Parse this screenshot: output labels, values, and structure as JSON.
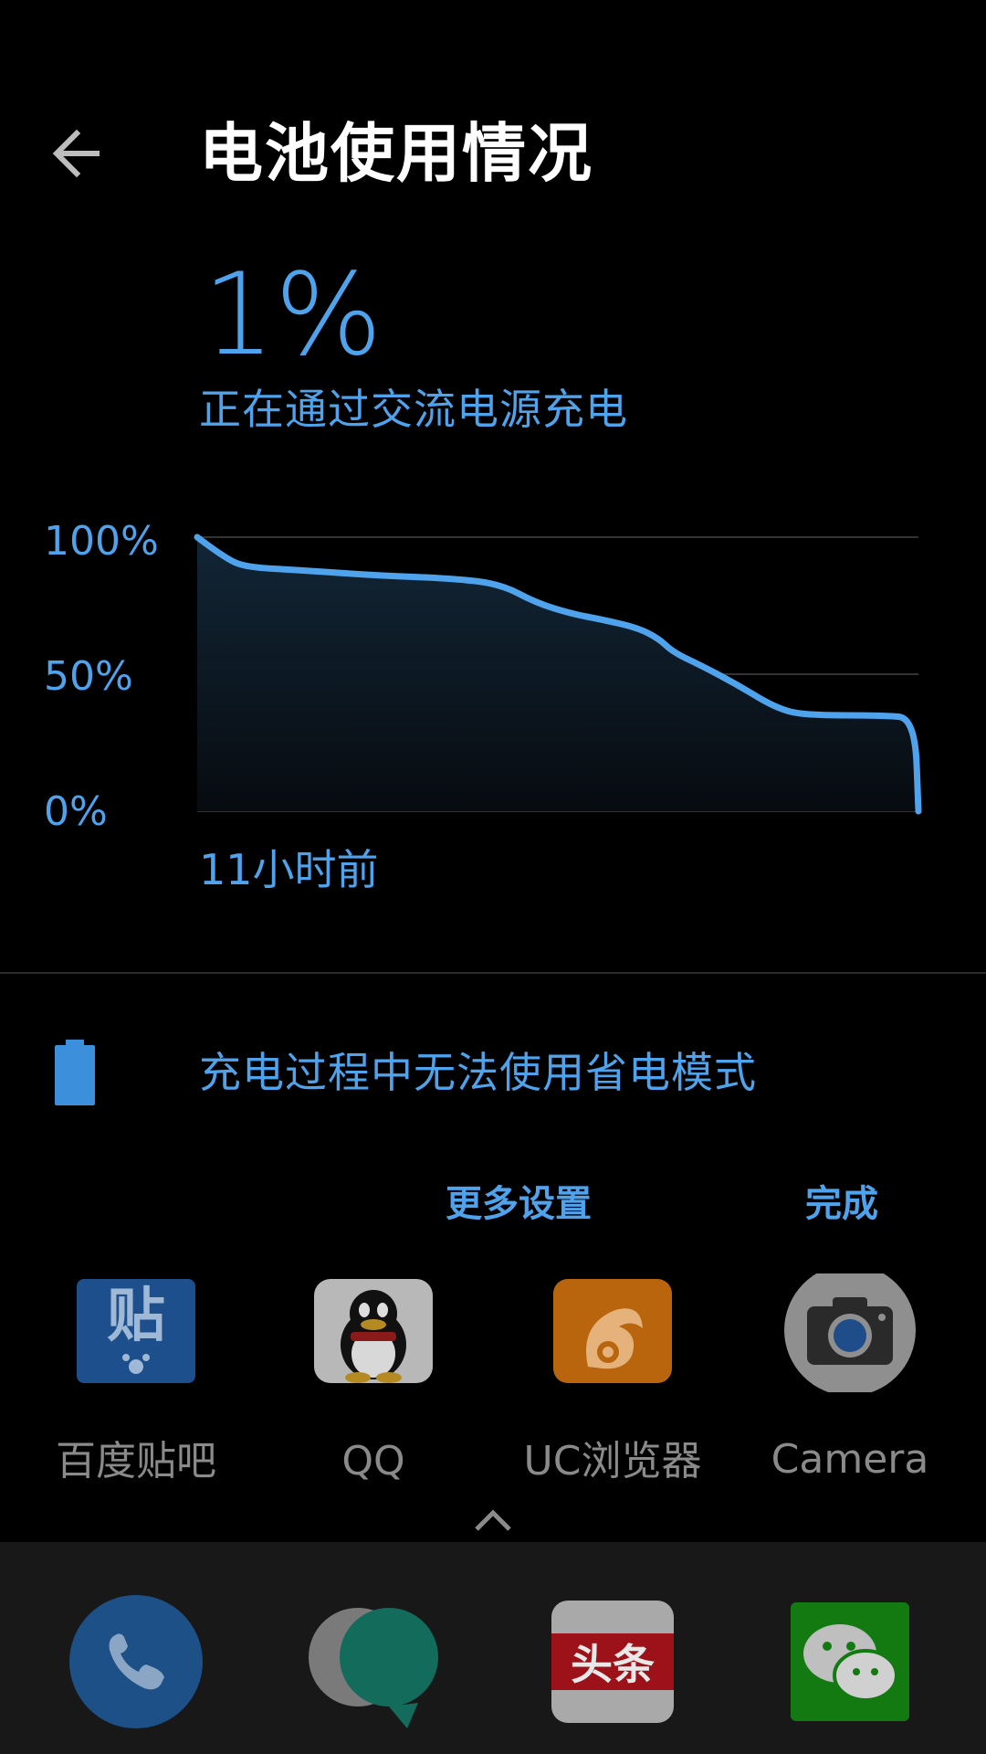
{
  "header": {
    "title": "电池使用情况"
  },
  "battery": {
    "percent": "1%",
    "status": "正在通过交流电源充电"
  },
  "chart_data": {
    "type": "area",
    "y_tick_labels": [
      "100%",
      "50%",
      "0%"
    ],
    "x_label": "11小时前",
    "ylim": [
      0,
      100
    ],
    "x": [
      0,
      0.04,
      0.07,
      0.14,
      0.25,
      0.35,
      0.42,
      0.47,
      0.52,
      0.56,
      0.61,
      0.64,
      0.66,
      0.7,
      0.75,
      0.8,
      0.84,
      0.95,
      0.995,
      1.0
    ],
    "values": [
      100,
      92,
      89,
      88,
      86,
      85,
      83,
      76,
      72,
      70,
      67,
      63,
      58,
      53,
      46,
      38,
      35,
      35,
      34,
      0
    ],
    "grid": true,
    "line_color": "#4ea3ec"
  },
  "saver": {
    "message": "充电过程中无法使用省电模式"
  },
  "actions": {
    "more_settings": "更多设置",
    "done": "完成"
  },
  "apps": [
    {
      "label": "百度贴吧",
      "icon": "tieba-icon"
    },
    {
      "label": "QQ",
      "icon": "qq-icon"
    },
    {
      "label": "UC浏览器",
      "icon": "uc-browser-icon"
    },
    {
      "label": "Camera",
      "icon": "camera-icon"
    }
  ],
  "dock": {
    "toutiao_text": "头条",
    "icons": [
      "phone-icon",
      "messages-icon",
      "toutiao-icon",
      "wechat-icon"
    ]
  },
  "colors": {
    "accent": "#4ea3ec",
    "background": "#000000"
  }
}
